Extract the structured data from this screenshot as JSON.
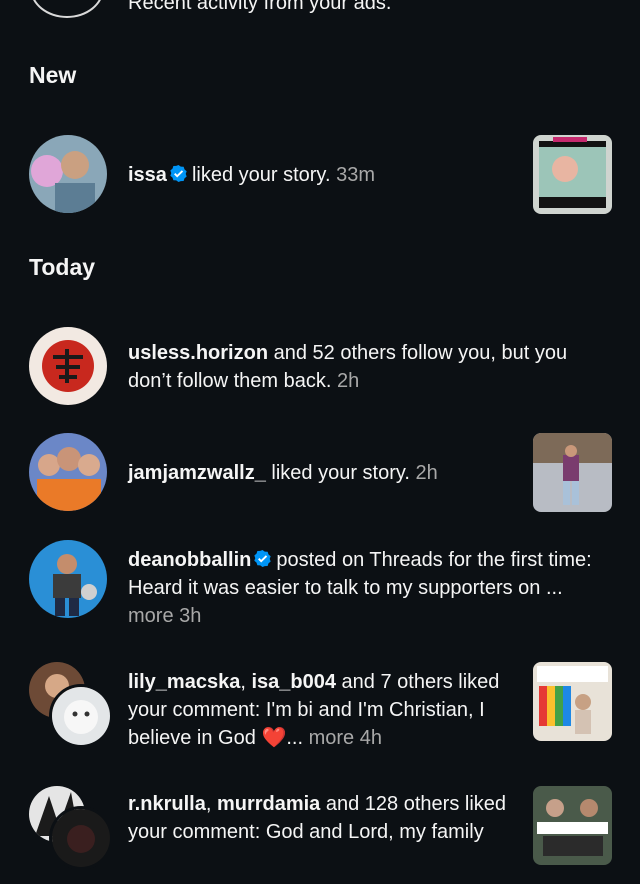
{
  "top": {
    "partial_text": "Recent activity from your ads."
  },
  "sections": {
    "new_title": "New",
    "today_title": "Today"
  },
  "items": [
    {
      "username": "issa",
      "verified": true,
      "action": "liked your story.",
      "time": "33m"
    },
    {
      "username": "usless.horizon",
      "action": "and 52 others follow you, but you don’t follow them back.",
      "time": "2h"
    },
    {
      "username": "jamjamzwallz_",
      "action": "liked your story.",
      "time": "2h"
    },
    {
      "username": "deanobballin",
      "verified": true,
      "action": "posted on Threads for the first time: Heard it was easier to talk to my supporters on ...",
      "more": "more",
      "time": "3h"
    },
    {
      "username1": "lily_macska",
      "sep": ",",
      "username2": "isa_b004",
      "action": "and 7 others liked your comment: I'm bi and I'm Christian, I believe in God",
      "heart": "❤️",
      "ellipsis": "...",
      "more": "more",
      "time": "4h"
    },
    {
      "username1": "r.nkrulla",
      "sep": ",",
      "username2": "murrdamia",
      "action": "and 128 others liked your comment: God and Lord, my family"
    }
  ],
  "icons": {
    "verified": "verified-badge-icon"
  },
  "colors": {
    "background": "#0c1014",
    "text": "#f5f5f5",
    "muted": "#a8a8a8",
    "verified": "#0095f6"
  }
}
